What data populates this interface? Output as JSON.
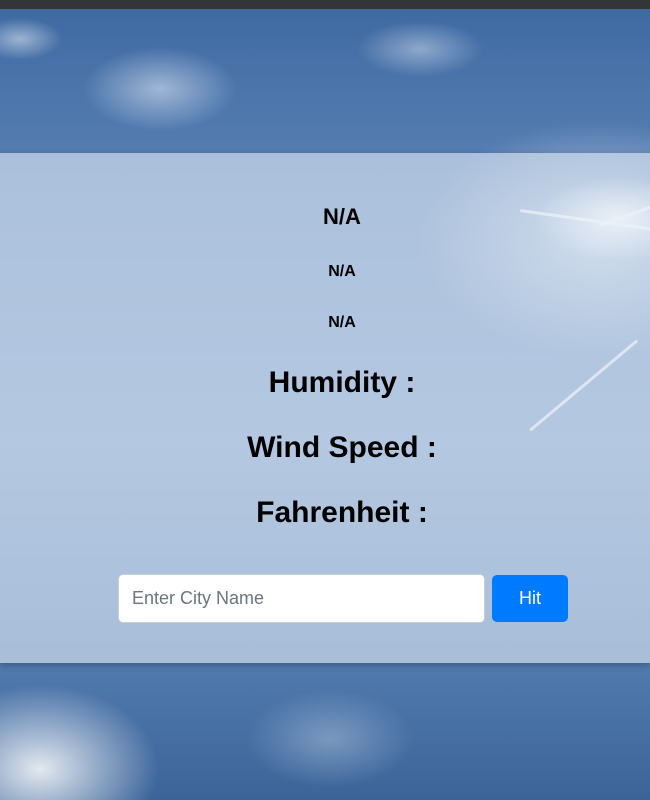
{
  "weather": {
    "city": "N/A",
    "temperature": "N/A",
    "description": "N/A",
    "humidity_label": "Humidity :",
    "wind_speed_label": "Wind Speed :",
    "fahrenheit_label": "Fahrenheit :"
  },
  "search": {
    "placeholder": "Enter City Name",
    "value": "",
    "button_label": "Hit"
  },
  "colors": {
    "button": "#007bff",
    "topbar": "#333538"
  }
}
